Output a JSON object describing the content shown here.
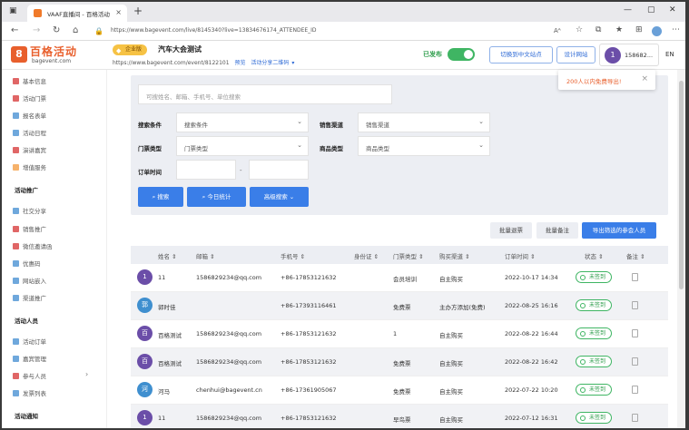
{
  "browser": {
    "tab_title": "VAAF直播间 - 百格活动",
    "url": "https://www.bagevent.com/live/8145340?live=13834676174_ATTENDEE_ID",
    "new_tab": "+",
    "close": "×"
  },
  "header": {
    "logo_mark": "8",
    "logo_text": "百格活动",
    "logo_sub": "bagevent.com",
    "badge": "企业版",
    "event_title": "汽车大会测试",
    "event_url": "https://www.bagevent.com/event/8122101",
    "preview": "预览",
    "qrcode": "活动分享二维码",
    "published": "已发布",
    "switch_en": "切换到中文站点",
    "design_site": "设计网站",
    "avatar_letter": "1",
    "user": "158682...",
    "lang": "EN"
  },
  "toast": {
    "text": "200人以内免费导出!",
    "close": "×"
  },
  "sidebar": {
    "items": [
      {
        "label": "基本信息",
        "color": "#e06666"
      },
      {
        "label": "活动门票",
        "color": "#e06666"
      },
      {
        "label": "报名表单",
        "color": "#6fa8dc"
      },
      {
        "label": "活动日程",
        "color": "#6fa8dc"
      },
      {
        "label": "演讲嘉宾",
        "color": "#e06666"
      },
      {
        "label": "增值服务",
        "color": "#f6b26b"
      }
    ],
    "group_promo": "活动推广",
    "promo_items": [
      {
        "label": "社交分享",
        "color": "#6fa8dc"
      },
      {
        "label": "销售推广",
        "color": "#e06666"
      },
      {
        "label": "微信邀请函",
        "color": "#e06666"
      },
      {
        "label": "优惠码",
        "color": "#6fa8dc"
      },
      {
        "label": "网站嵌入",
        "color": "#6fa8dc"
      },
      {
        "label": "渠道推广",
        "color": "#6fa8dc"
      }
    ],
    "group_people": "活动人员",
    "people_items": [
      {
        "label": "活动订单",
        "color": "#6fa8dc"
      },
      {
        "label": "嘉宾管理",
        "color": "#6fa8dc"
      },
      {
        "label": "参与人员",
        "color": "#e06666"
      },
      {
        "label": "发票列表",
        "color": "#6fa8dc"
      }
    ],
    "group_notify": "活动通知"
  },
  "filter": {
    "keyword_placeholder": "可搜姓名、邮箱、手机号、单位搜索",
    "search_cond_label": "搜索条件",
    "search_cond_value": "搜索条件",
    "channel_label": "销售渠道",
    "channel_value": "销售渠道",
    "ticket_label": "门票类型",
    "ticket_value": "门票类型",
    "product_label": "商品类型",
    "product_value": "商品类型",
    "order_time_label": "订单时间",
    "dash": "-",
    "search_btn": "搜索",
    "today_btn": "今日统计",
    "advanced_btn": "高级搜索"
  },
  "actions": {
    "batch_reject": "批量退票",
    "batch_note": "批量备注",
    "export": "导出筛选的参会人员"
  },
  "table": {
    "headers": [
      "姓名 ⇕",
      "邮箱 ⇕",
      "手机号 ⇕",
      "身份证 ⇕",
      "门票类型 ⇕",
      "购买渠道 ⇕",
      "订单时间 ⇕",
      "状态 ⇕",
      "备注 ⇕"
    ],
    "rows": [
      {
        "avatar": "1",
        "color": "#6b4ea8",
        "name": "11",
        "email": "1586829234@qq.com",
        "phone": "+86-17853121632",
        "ticket": "会员培训",
        "channel": "自主购买",
        "time": "2022-10-17 14:34",
        "status": "未签到"
      },
      {
        "avatar": "郭",
        "color": "#3f8fcf",
        "name": "郭时佳",
        "email": "",
        "phone": "+86-17393116461",
        "ticket": "免费票",
        "channel": "主办方添加(免费)",
        "time": "2022-08-25 16:16",
        "status": "未签到"
      },
      {
        "avatar": "百",
        "color": "#6b4ea8",
        "name": "百格测试",
        "email": "1586829234@qq.com",
        "phone": "+86-17853121632",
        "ticket": "1",
        "channel": "自主购买",
        "time": "2022-08-22 16:44",
        "status": "未签到"
      },
      {
        "avatar": "百",
        "color": "#6b4ea8",
        "name": "百格测试",
        "email": "1586829234@qq.com",
        "phone": "+86-17853121632",
        "ticket": "免费票",
        "channel": "自主购买",
        "time": "2022-08-22 16:42",
        "status": "未签到"
      },
      {
        "avatar": "河",
        "color": "#3f8fcf",
        "name": "河马",
        "email": "chenhui@bagevent.cn",
        "phone": "+86-17361905067",
        "ticket": "免费票",
        "channel": "自主购买",
        "time": "2022-07-22 10:20",
        "status": "未签到"
      },
      {
        "avatar": "1",
        "color": "#6b4ea8",
        "name": "11",
        "email": "1586829234@qq.com",
        "phone": "+86-17853121632",
        "ticket": "早鸟票",
        "channel": "自主购买",
        "time": "2022-07-12 16:31",
        "status": "未签到"
      }
    ]
  }
}
